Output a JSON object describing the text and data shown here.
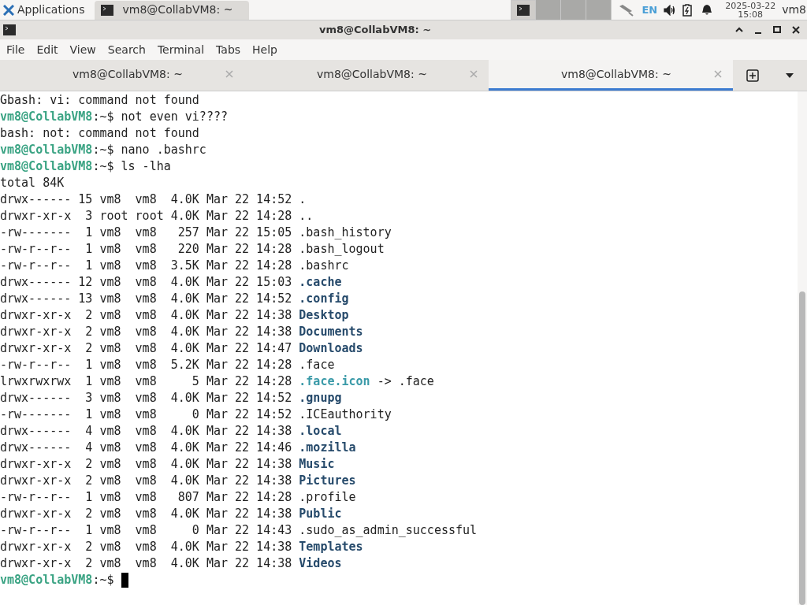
{
  "panel": {
    "applications": "Applications",
    "task": {
      "title": "vm8@CollabVM8: ~",
      "selected": true
    },
    "workspaces": [
      {
        "selected": true
      },
      {
        "selected": false
      },
      {
        "selected": false
      },
      {
        "selected": false
      }
    ],
    "layout": "EN",
    "date": "2025-03-22",
    "time": "15:08",
    "user": "vm8"
  },
  "window": {
    "title": "vm8@CollabVM8: ~"
  },
  "menu": [
    "File",
    "Edit",
    "View",
    "Search",
    "Terminal",
    "Tabs",
    "Help"
  ],
  "tabs": [
    {
      "label": "vm8@CollabVM8: ~",
      "selected": false
    },
    {
      "label": "vm8@CollabVM8: ~",
      "selected": false
    },
    {
      "label": "vm8@CollabVM8: ~",
      "selected": true
    }
  ],
  "lines": [
    {
      "kind": "output",
      "text": "Gbash: vi: command not found"
    },
    {
      "kind": "prompt",
      "user_host": "vm8@CollabVM8",
      "path": ":~$",
      "command": "not even vi????"
    },
    {
      "kind": "output",
      "text": "bash: not: command not found"
    },
    {
      "kind": "prompt",
      "user_host": "vm8@CollabVM8",
      "path": ":~$",
      "command": "nano .bashrc"
    },
    {
      "kind": "prompt",
      "user_host": "vm8@CollabVM8",
      "path": ":~$",
      "command": "ls -lha"
    },
    {
      "kind": "output",
      "text": "total 84K"
    },
    {
      "kind": "entry",
      "info": "drwx------ 15 vm8  vm8  4.0K Mar 22 14:52",
      "name": ".",
      "directory": false,
      "symlink": false
    },
    {
      "kind": "entry",
      "info": "drwxr-xr-x  3 root root 4.0K Mar 22 14:28",
      "name": "..",
      "directory": false,
      "symlink": false
    },
    {
      "kind": "entry",
      "info": "-rw-------  1 vm8  vm8   257 Mar 22 15:05",
      "name": ".bash_history",
      "directory": false,
      "symlink": false
    },
    {
      "kind": "entry",
      "info": "-rw-r--r--  1 vm8  vm8   220 Mar 22 14:28",
      "name": ".bash_logout",
      "directory": false,
      "symlink": false
    },
    {
      "kind": "entry",
      "info": "-rw-r--r--  1 vm8  vm8  3.5K Mar 22 14:28",
      "name": ".bashrc",
      "directory": false,
      "symlink": false
    },
    {
      "kind": "entry",
      "info": "drwx------ 12 vm8  vm8  4.0K Mar 22 15:03",
      "name": ".cache",
      "directory": true,
      "symlink": false
    },
    {
      "kind": "entry",
      "info": "drwx------ 13 vm8  vm8  4.0K Mar 22 14:52",
      "name": ".config",
      "directory": true,
      "symlink": false
    },
    {
      "kind": "entry",
      "info": "drwxr-xr-x  2 vm8  vm8  4.0K Mar 22 14:38",
      "name": "Desktop",
      "directory": true,
      "symlink": false
    },
    {
      "kind": "entry",
      "info": "drwxr-xr-x  2 vm8  vm8  4.0K Mar 22 14:38",
      "name": "Documents",
      "directory": true,
      "symlink": false
    },
    {
      "kind": "entry",
      "info": "drwxr-xr-x  2 vm8  vm8  4.0K Mar 22 14:47",
      "name": "Downloads",
      "directory": true,
      "symlink": false
    },
    {
      "kind": "entry",
      "info": "-rw-r--r--  1 vm8  vm8  5.2K Mar 22 14:28",
      "name": ".face",
      "directory": false,
      "symlink": false
    },
    {
      "kind": "entry",
      "info": "lrwxrwxrwx  1 vm8  vm8     5 Mar 22 14:28",
      "name": ".face.icon",
      "symlink": true,
      "target": "-> .face"
    },
    {
      "kind": "entry",
      "info": "drwx------  3 vm8  vm8  4.0K Mar 22 14:52",
      "name": ".gnupg",
      "directory": true,
      "symlink": false
    },
    {
      "kind": "entry",
      "info": "-rw-------  1 vm8  vm8     0 Mar 22 14:52",
      "name": ".ICEauthority",
      "directory": false,
      "symlink": false
    },
    {
      "kind": "entry",
      "info": "drwx------  4 vm8  vm8  4.0K Mar 22 14:38",
      "name": ".local",
      "directory": true,
      "symlink": false
    },
    {
      "kind": "entry",
      "info": "drwx------  4 vm8  vm8  4.0K Mar 22 14:46",
      "name": ".mozilla",
      "directory": true,
      "symlink": false
    },
    {
      "kind": "entry",
      "info": "drwxr-xr-x  2 vm8  vm8  4.0K Mar 22 14:38",
      "name": "Music",
      "directory": true,
      "symlink": false
    },
    {
      "kind": "entry",
      "info": "drwxr-xr-x  2 vm8  vm8  4.0K Mar 22 14:38",
      "name": "Pictures",
      "directory": true,
      "symlink": false
    },
    {
      "kind": "entry",
      "info": "-rw-r--r--  1 vm8  vm8   807 Mar 22 14:28",
      "name": ".profile",
      "directory": false,
      "symlink": false
    },
    {
      "kind": "entry",
      "info": "drwxr-xr-x  2 vm8  vm8  4.0K Mar 22 14:38",
      "name": "Public",
      "directory": true,
      "symlink": false
    },
    {
      "kind": "entry",
      "info": "-rw-r--r--  1 vm8  vm8     0 Mar 22 14:43",
      "name": ".sudo_as_admin_successful",
      "directory": false,
      "symlink": false
    },
    {
      "kind": "entry",
      "info": "drwxr-xr-x  2 vm8  vm8  4.0K Mar 22 14:38",
      "name": "Templates",
      "directory": true,
      "symlink": false
    },
    {
      "kind": "entry",
      "info": "drwxr-xr-x  2 vm8  vm8  4.0K Mar 22 14:38",
      "name": "Videos",
      "directory": true,
      "symlink": false
    },
    {
      "kind": "prompt",
      "user_host": "vm8@CollabVM8",
      "path": ":~$",
      "cursor": true
    }
  ]
}
